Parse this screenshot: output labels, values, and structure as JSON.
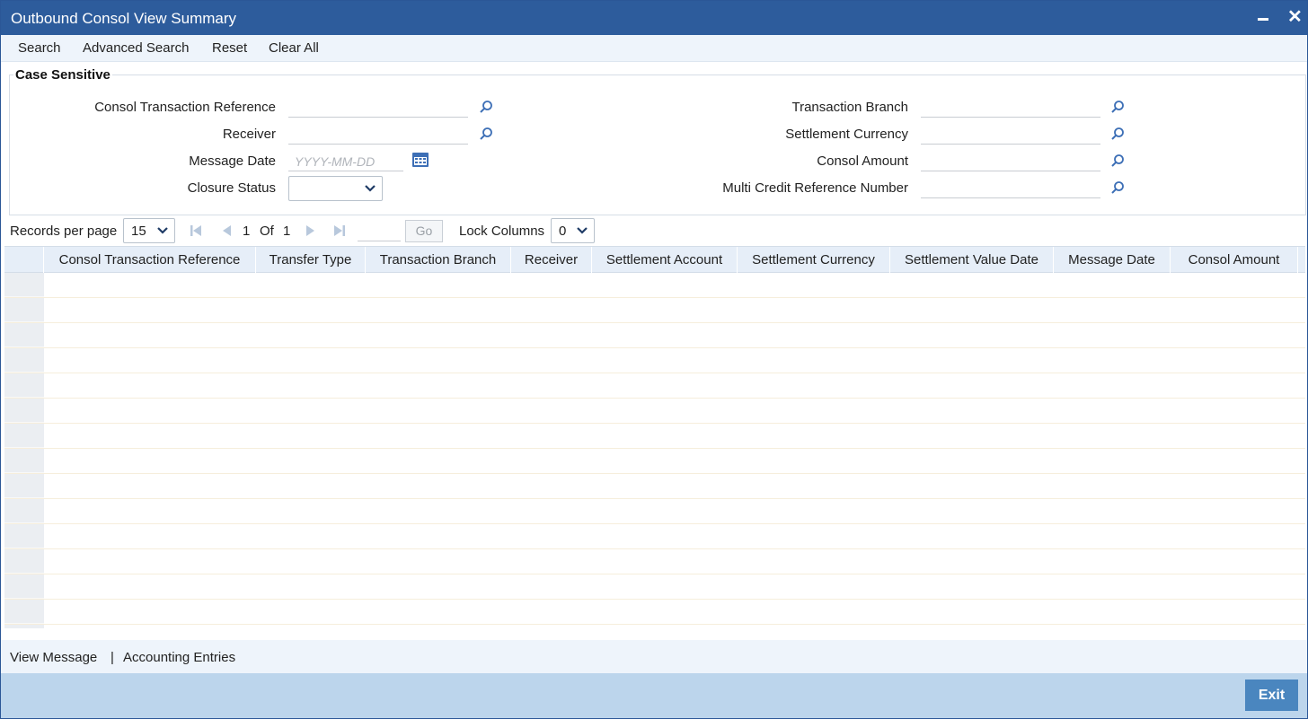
{
  "window": {
    "title": "Outbound Consol View Summary"
  },
  "toolbar": {
    "search": "Search",
    "advanced_search": "Advanced Search",
    "reset": "Reset",
    "clear_all": "Clear All"
  },
  "search_panel": {
    "legend": "Case Sensitive",
    "fields": {
      "consol_ref": {
        "label": "Consol Transaction Reference",
        "value": ""
      },
      "receiver": {
        "label": "Receiver",
        "value": ""
      },
      "message_date": {
        "label": "Message Date",
        "placeholder": "YYYY-MM-DD",
        "value": ""
      },
      "closure_status": {
        "label": "Closure Status",
        "value": ""
      },
      "txn_branch": {
        "label": "Transaction Branch",
        "value": ""
      },
      "settlement_currency": {
        "label": "Settlement Currency",
        "value": ""
      },
      "consol_amount": {
        "label": "Consol Amount",
        "value": ""
      },
      "multi_credit_ref": {
        "label": "Multi Credit Reference Number",
        "value": ""
      }
    }
  },
  "pager": {
    "records_label": "Records per page",
    "records_value": "15",
    "current_page": "1",
    "of_label": "Of",
    "total_pages": "1",
    "go_label": "Go",
    "lock_label": "Lock Columns",
    "lock_value": "0"
  },
  "grid": {
    "columns": [
      "Consol Transaction Reference",
      "Transfer Type",
      "Transaction Branch",
      "Receiver",
      "Settlement Account",
      "Settlement Currency",
      "Settlement Value Date",
      "Message Date",
      "Consol Amount"
    ],
    "row_count": 15
  },
  "footer": {
    "view_message": "View Message",
    "separator": "|",
    "accounting_entries": "Accounting Entries",
    "exit": "Exit"
  },
  "colors": {
    "titlebar": "#2d5c9c",
    "toolbar": "#eef4fb",
    "footer_bar": "#bcd5ec",
    "exit_button": "#4a86bf",
    "lookup_icon": "#3d6fb6"
  }
}
